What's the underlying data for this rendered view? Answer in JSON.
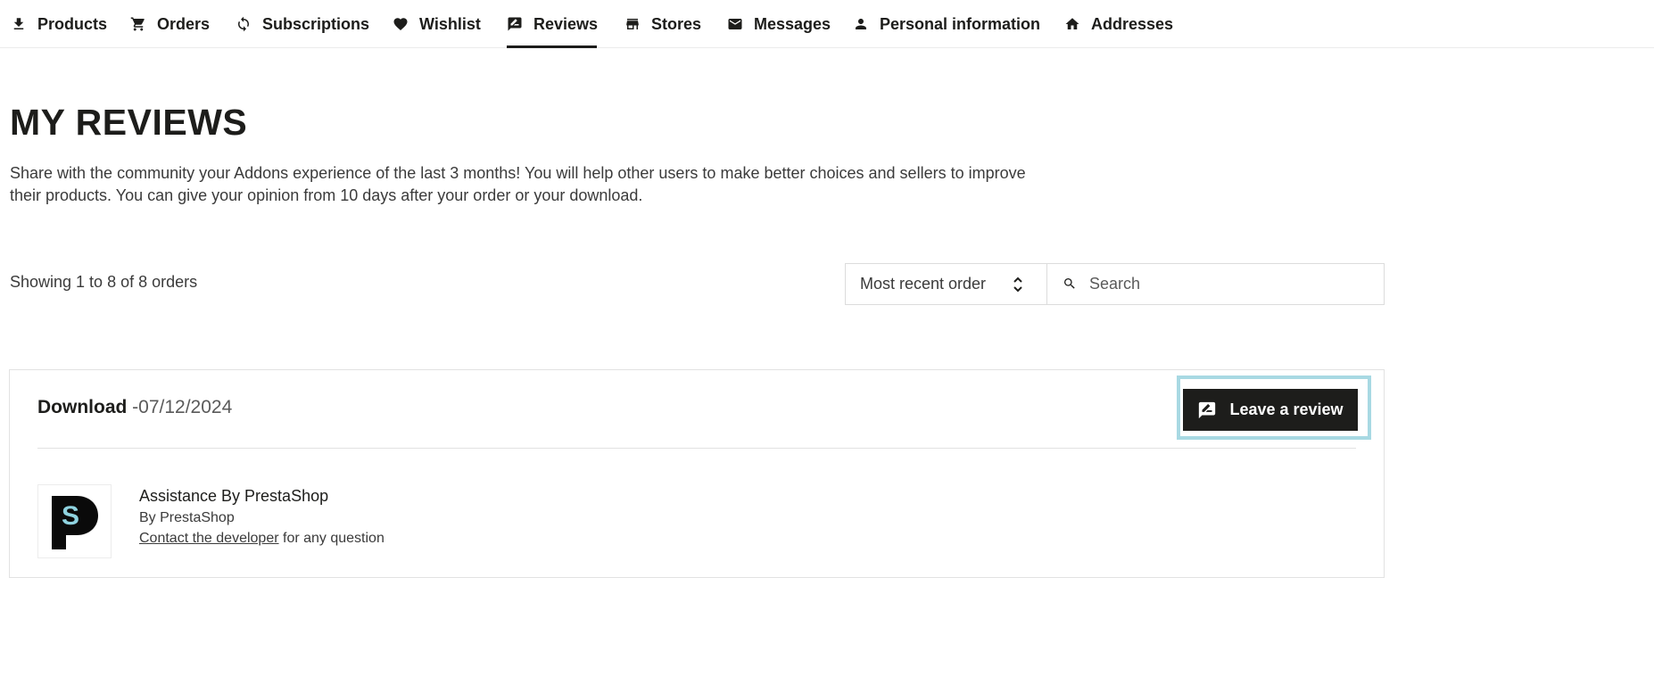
{
  "nav": {
    "tabs": [
      {
        "label": "Products",
        "icon": "download-icon"
      },
      {
        "label": "Orders",
        "icon": "cart-icon"
      },
      {
        "label": "Subscriptions",
        "icon": "sync-icon"
      },
      {
        "label": "Wishlist",
        "icon": "heart-icon"
      },
      {
        "label": "Reviews",
        "icon": "rate-review-icon",
        "active": true
      },
      {
        "label": "Stores",
        "icon": "store-icon"
      },
      {
        "label": "Messages",
        "icon": "mail-icon"
      },
      {
        "label": "Personal information",
        "icon": "person-icon"
      },
      {
        "label": "Addresses",
        "icon": "home-icon"
      }
    ]
  },
  "page": {
    "title": "MY REVIEWS",
    "intro": "Share with the community your Addons experience of the last 3 months! You will help other users to make better choices and sellers to improve their products. You can give your opinion from 10 days after your order or your download."
  },
  "list": {
    "showing": "Showing 1 to 8 of 8 orders",
    "sort_value": "Most recent order",
    "search_placeholder": "Search"
  },
  "order": {
    "type": "Download",
    "date": "-07/12/2024",
    "review_button": "Leave a review",
    "product": {
      "name": "Assistance By PrestaShop",
      "by": "By PrestaShop",
      "contact_link": "Contact the developer",
      "contact_suffix": " for any question"
    }
  },
  "colors": {
    "text": "#1d1d1b",
    "button_bg": "#1d1d1b",
    "highlight_outline": "#a8d9e3",
    "logo_accent": "#8fd3e0"
  }
}
